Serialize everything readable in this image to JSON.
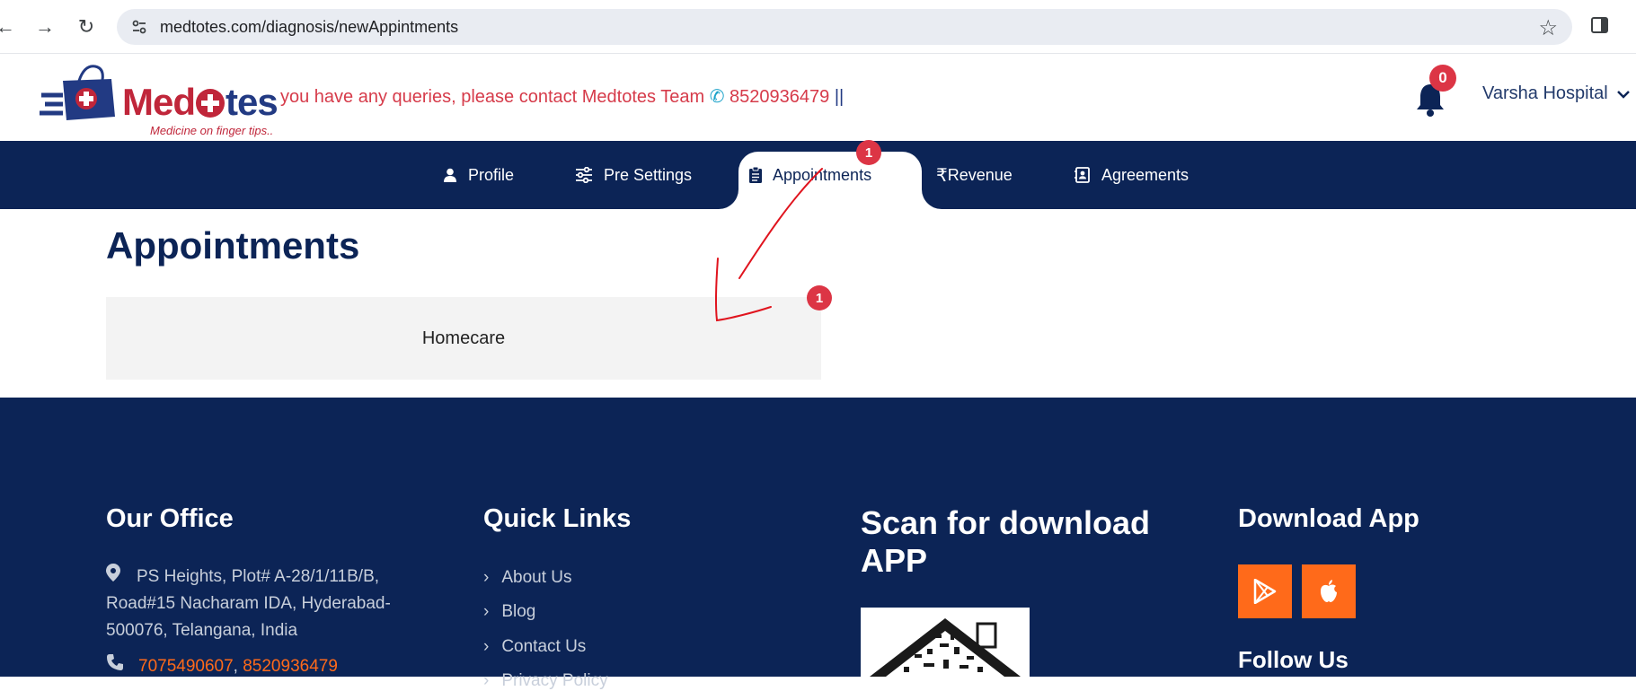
{
  "browser": {
    "url": "medtotes.com/diagnosis/newAppintments"
  },
  "header": {
    "logo_left": "Med",
    "logo_right": "tes",
    "logo_tagline": "Medicine on finger tips..",
    "marquee_text": "you have any queries, please contact Medtotes Team",
    "marquee_phone": "8520936479",
    "marquee_sep": "||",
    "notification_count": "0",
    "user_name": "Varsha Hospital"
  },
  "nav": {
    "items": [
      {
        "label": "Profile",
        "icon": "user-icon"
      },
      {
        "label": "Pre Settings",
        "icon": "sliders-icon"
      },
      {
        "label": "Appointments",
        "icon": "clipboard-icon"
      },
      {
        "label": "Revenue",
        "icon": "rupee-icon"
      },
      {
        "label": "Agreements",
        "icon": "contact-book-icon"
      }
    ],
    "active": "Appointments",
    "appointments_badge": "1"
  },
  "main": {
    "title": "Appointments",
    "cards": [
      {
        "label": "Homecare",
        "badge": "1"
      }
    ]
  },
  "footer": {
    "office_title": "Our Office",
    "address_line1": "PS Heights, Plot# A-28/1/11B/B,",
    "address_line2": "Road#15 Nacharam IDA, Hyderabad-",
    "address_line3": "500076, Telangana, India",
    "phone1": "7075490607",
    "phone_sep": ",",
    "phone2": "8520936479",
    "links_title": "Quick Links",
    "links": [
      "About Us",
      "Blog",
      "Contact Us",
      "Privacy Policy"
    ],
    "scan_title_line1": "Scan for download",
    "scan_title_line2": "APP",
    "download_title": "Download App",
    "follow_title": "Follow Us"
  },
  "colors": {
    "navy": "#0c2456",
    "brand_red": "#c0263a",
    "badge_red": "#dc3545",
    "orange": "#ff6a1a",
    "annotation_red": "#e0141e"
  }
}
